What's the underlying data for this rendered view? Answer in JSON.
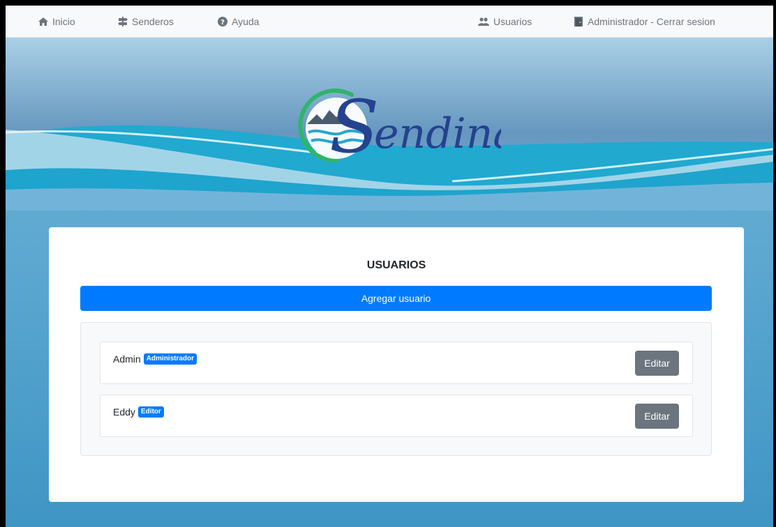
{
  "navbar": {
    "home_label": "Inicio",
    "trails_label": "Senderos",
    "help_label": "Ayuda",
    "users_label": "Usuarios",
    "logout_label": "Administrador - Cerrar sesion"
  },
  "logo": {
    "text": "endina"
  },
  "card": {
    "title": "USUARIOS",
    "add_button_label": "Agregar usuario"
  },
  "users": [
    {
      "name": "Admin",
      "role": "Administrador",
      "edit_label": "Editar"
    },
    {
      "name": "Eddy",
      "role": "Editor",
      "edit_label": "Editar"
    }
  ],
  "colors": {
    "primary": "#007bff",
    "secondary": "#6c757d",
    "navbar_bg": "#f8f9fa",
    "logo_green": "#2fb56a",
    "logo_blue": "#24428f"
  },
  "icons": {
    "home": "home-icon",
    "trails": "signpost-icon",
    "help": "question-circle-icon",
    "users": "users-icon",
    "logout": "door-icon"
  }
}
